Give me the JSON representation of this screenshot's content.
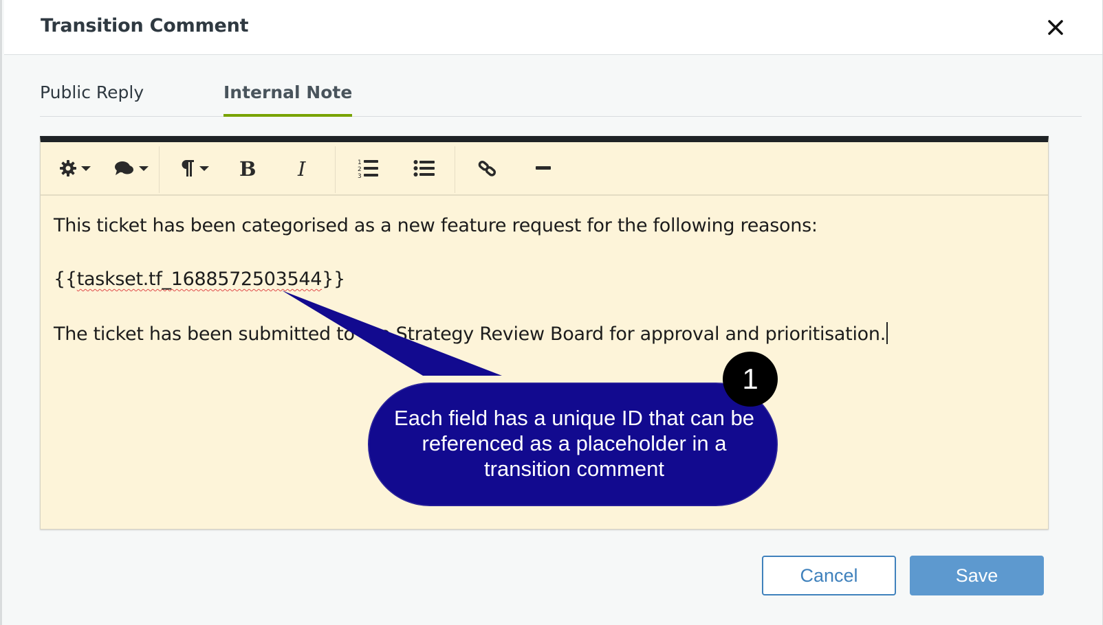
{
  "dialog": {
    "title": "Transition Comment"
  },
  "tabs": [
    {
      "label": "Public Reply",
      "active": false
    },
    {
      "label": "Internal Note",
      "active": true
    }
  ],
  "toolbar": {
    "items": [
      {
        "icon": "gear-icon",
        "dropdown": true
      },
      {
        "icon": "comments-icon",
        "dropdown": true
      },
      {
        "icon": "paragraph-icon",
        "dropdown": true
      },
      {
        "icon": "bold-icon"
      },
      {
        "icon": "italic-icon"
      },
      {
        "icon": "ordered-list-icon"
      },
      {
        "icon": "unordered-list-icon"
      },
      {
        "icon": "link-icon"
      },
      {
        "icon": "horizontal-rule-icon"
      }
    ]
  },
  "editor": {
    "line1": "This ticket has been categorised as a new feature request for the following reasons:",
    "placeholder_prefix": "{{",
    "placeholder_name": "taskset.tf_1688572503544",
    "placeholder_suffix": "}}",
    "line3": "The ticket has been submitted to the Strategy Review Board for approval and prioritisation."
  },
  "callout": {
    "number": "1",
    "text": "Each field has a unique ID that can be referenced as a placeholder in a transition comment",
    "color": "#120a8f"
  },
  "footer": {
    "cancel_label": "Cancel",
    "save_label": "Save"
  },
  "colors": {
    "active_tab_underline": "#78a300",
    "editor_background": "#fdf4d9",
    "primary_button": "#5d99cf"
  }
}
